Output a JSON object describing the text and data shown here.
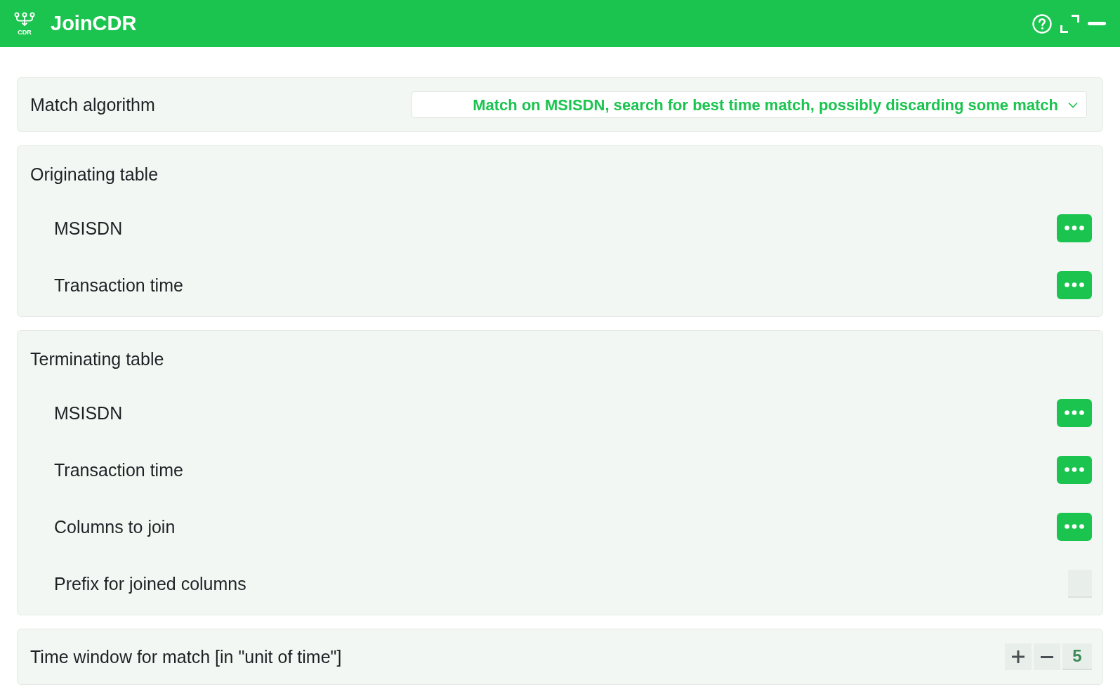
{
  "app": {
    "title": "JoinCDR",
    "logo_text": "CDR"
  },
  "match_algorithm": {
    "label": "Match algorithm",
    "value": "Match on MSISDN, search for best time match, possibly discarding some match"
  },
  "sections": [
    {
      "title": "Originating table",
      "fields": [
        {
          "label": "MSISDN",
          "kind": "picker"
        },
        {
          "label": "Transaction time",
          "kind": "picker"
        }
      ]
    },
    {
      "title": "Terminating table",
      "fields": [
        {
          "label": "MSISDN",
          "kind": "picker"
        },
        {
          "label": "Transaction time",
          "kind": "picker"
        },
        {
          "label": "Columns to join",
          "kind": "picker"
        },
        {
          "label": "Prefix for joined columns",
          "kind": "text"
        }
      ]
    }
  ],
  "time_window": {
    "label": "Time window for match [in \"unit of time\"]",
    "value": "5"
  }
}
